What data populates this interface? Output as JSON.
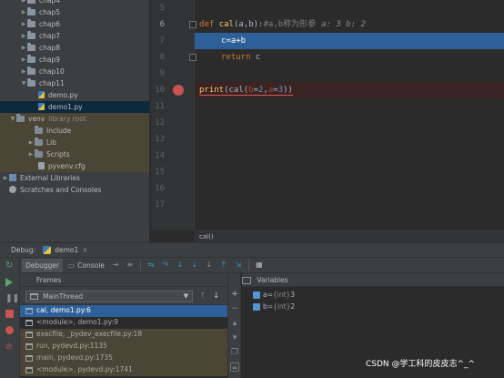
{
  "project_tree": {
    "items": [
      {
        "label": "chap4",
        "icon": "folder-icon",
        "arrow": "▶"
      },
      {
        "label": "chap5",
        "icon": "folder-icon",
        "arrow": "▶"
      },
      {
        "label": "chap6",
        "icon": "folder-icon",
        "arrow": "▶"
      },
      {
        "label": "chap7",
        "icon": "folder-icon",
        "arrow": "▶"
      },
      {
        "label": "chap8",
        "icon": "folder-icon",
        "arrow": "▶"
      },
      {
        "label": "chap9",
        "icon": "folder-icon",
        "arrow": "▶"
      },
      {
        "label": "chap10",
        "icon": "folder-icon",
        "arrow": "▶"
      },
      {
        "label": "chap11",
        "icon": "folder-icon",
        "arrow": "▼"
      },
      {
        "label": "demo.py",
        "icon": "python-file-icon",
        "arrow": ""
      },
      {
        "label": "demo1.py",
        "icon": "python-file-icon",
        "arrow": ""
      },
      {
        "label": "venv",
        "sublabel": "library root",
        "icon": "folder-icon",
        "arrow": "▼"
      },
      {
        "label": "Include",
        "icon": "folder-icon",
        "arrow": ""
      },
      {
        "label": "Lib",
        "icon": "folder-icon",
        "arrow": "▶"
      },
      {
        "label": "Scripts",
        "icon": "folder-icon",
        "arrow": "▶"
      },
      {
        "label": "pyvenv.cfg",
        "icon": "config-file-icon",
        "arrow": ""
      },
      {
        "label": "External Libraries",
        "icon": "external-libraries-icon",
        "arrow": "▶"
      },
      {
        "label": "Scratches and Consoles",
        "icon": "scratches-icon",
        "arrow": ""
      }
    ]
  },
  "editor": {
    "line_numbers": [
      "5",
      "6",
      "7",
      "8",
      "9",
      "10",
      "11",
      "12",
      "13",
      "14",
      "15",
      "16",
      "17"
    ],
    "current_line": "6",
    "breakpoint_line": "9",
    "code": {
      "l5_kw": "def ",
      "l5_fn": "cal",
      "l5_params": "(a,b):",
      "l5_comment": "#a,b称为形参",
      "l5_inline": "a: 3  b: 2",
      "l6": "c=a+b",
      "l7_kw": "return",
      "l7_rest": " c",
      "l9_print": "print",
      "l9_open": "(cal(",
      "l9_b": "b",
      "l9_eq1": "=",
      "l9_v1": "2",
      "l9_comma": ",",
      "l9_a": "a",
      "l9_eq2": "=",
      "l9_v2": "3",
      "l9_close": "))"
    },
    "breadcrumb": "cal()"
  },
  "debug": {
    "title": "Debug:",
    "session_tab": "demo1",
    "close": "×",
    "tabs": {
      "debugger": "Debugger",
      "console": "Console"
    },
    "frames_header": "Frames",
    "variables_header": "Variables",
    "thread": "MainThread",
    "frames": [
      "cal, demo1.py:6",
      "<module>, demo1.py:9",
      "execfile, _pydev_execfile.py:18",
      "run, pydevd.py:1135",
      "main, pydevd.py:1735",
      "<module>, pydevd.py:1741"
    ],
    "variables": [
      {
        "name": "a",
        "eq": " = ",
        "type": "{int}",
        "value": " 3"
      },
      {
        "name": "b",
        "eq": " = ",
        "type": "{int}",
        "value": " 2"
      }
    ]
  },
  "watermark": "CSDN @学工科的皮皮志^_^",
  "colors": {
    "accent": "#2d6099",
    "breakpoint": "#c75450",
    "keyword": "#cc7832",
    "function": "#ffc66d",
    "number": "#6897bb"
  }
}
